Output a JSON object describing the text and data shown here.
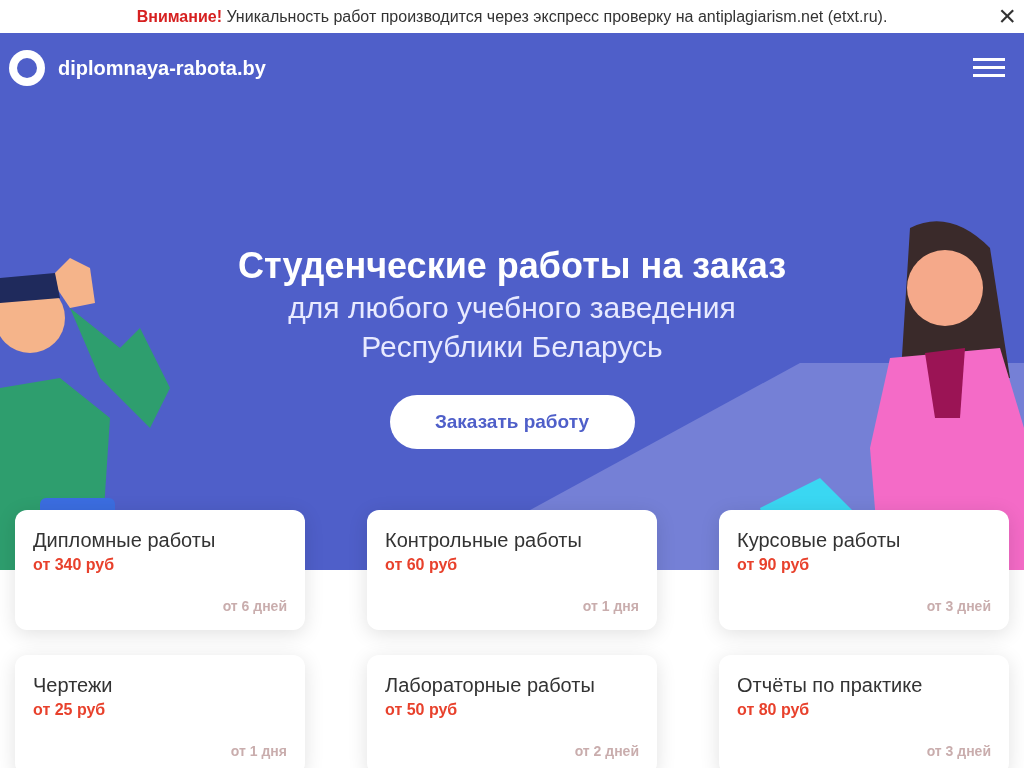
{
  "notice": {
    "label": "Внимание!",
    "text": "Уникальность работ производится через экспресс проверку на antiplagiarism.net (etxt.ru).",
    "close": "×"
  },
  "header": {
    "site_name": "diplomnaya-rabota.by"
  },
  "hero": {
    "title": "Студенческие работы на заказ",
    "subtitle_lines": [
      "для любого учебного заведения",
      "Республики Беларусь"
    ],
    "button": "Заказать работу"
  },
  "cards": [
    {
      "title": "Дипломные работы",
      "price": "от 340 руб",
      "term": "от 6 дней"
    },
    {
      "title": "Контрольные работы",
      "price": "от 60 руб",
      "term": "от 1 дня"
    },
    {
      "title": "Курсовые работы",
      "price": "от 90 руб",
      "term": "от 3 дней"
    },
    {
      "title": "Чертежи",
      "price": "от 25 руб",
      "term": "от 1 дня"
    },
    {
      "title": "Лабораторные работы",
      "price": "от 50 руб",
      "term": "от 2 дней"
    },
    {
      "title": "Отчёты по практике",
      "price": "от 80 руб",
      "term": "от 3 дней"
    }
  ]
}
